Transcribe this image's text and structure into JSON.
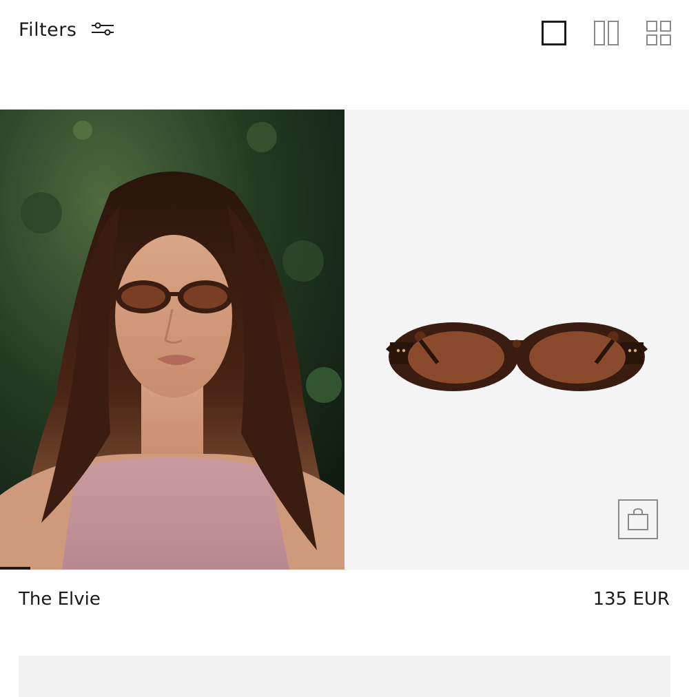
{
  "toolbar": {
    "filters_label": "Filters",
    "filters_icon": "sliders-icon",
    "view_options": [
      {
        "name": "single-column-view",
        "icon": "square-icon"
      },
      {
        "name": "two-column-view",
        "icon": "two-columns-icon"
      },
      {
        "name": "grid-view",
        "icon": "grid-icon"
      }
    ]
  },
  "product": {
    "name": "The Elvie",
    "price": "135 EUR",
    "images": [
      "model-photo",
      "sunglasses-packshot"
    ],
    "add_to_cart_icon": "shopping-bag-icon"
  },
  "colors": {
    "text": "#1a1a1a",
    "packshot_background": "#f4f4f4",
    "icon_gray": "#8a8a8a",
    "lens_brown": "#8a4a2c",
    "tortoise_frame": "#3a1c10"
  }
}
